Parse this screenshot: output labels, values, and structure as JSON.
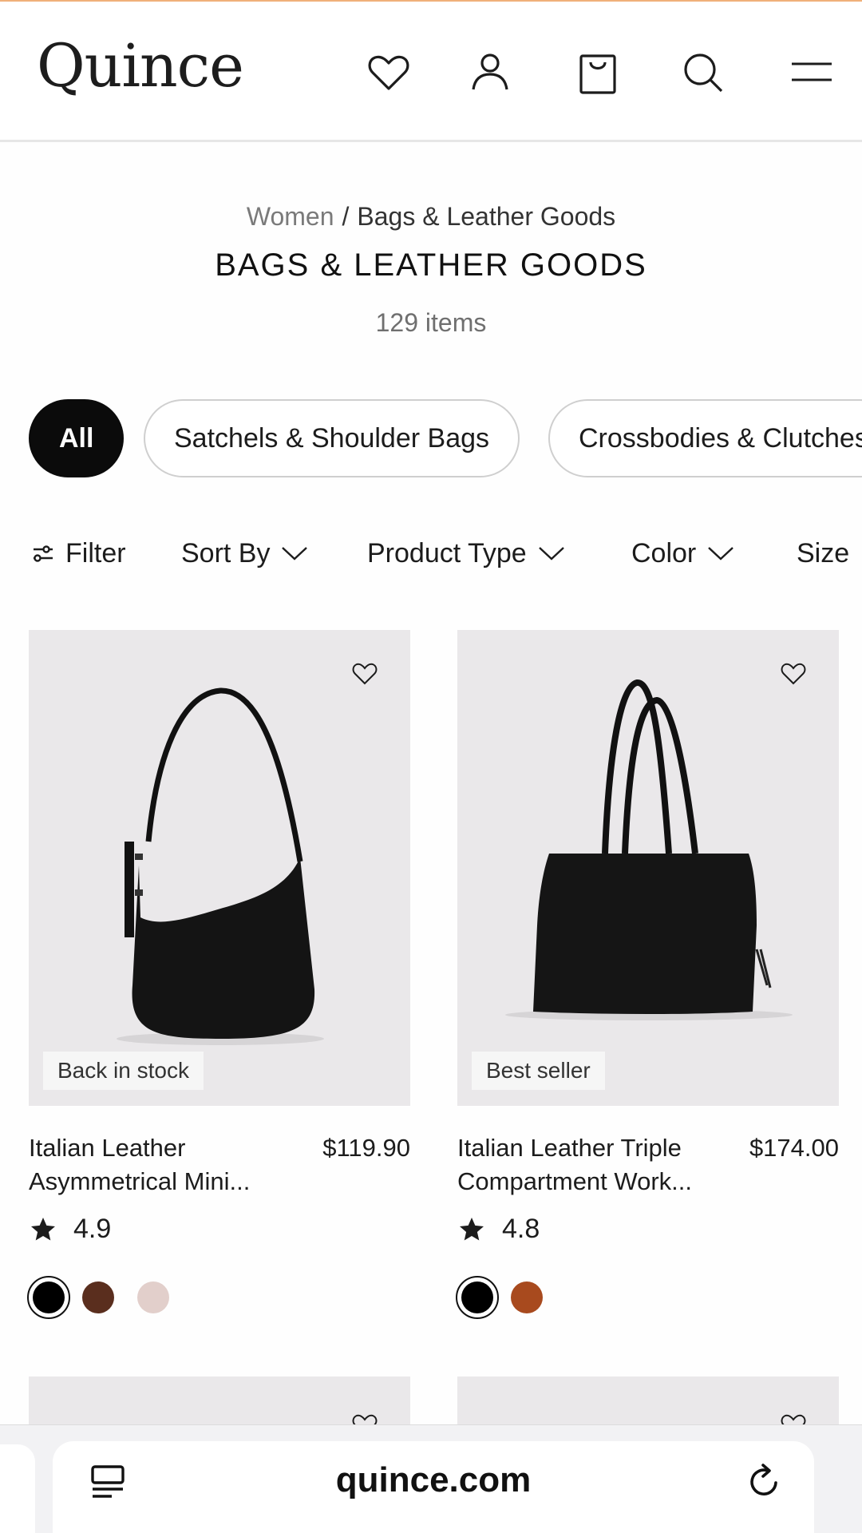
{
  "header": {
    "logo": "Quince",
    "icons": [
      "heart-icon",
      "account-icon",
      "bag-icon",
      "search-icon",
      "menu-icon"
    ]
  },
  "breadcrumb": {
    "parent": "Women",
    "separator": "/",
    "current": "Bags & Leather Goods"
  },
  "page": {
    "title": "BAGS & LEATHER GOODS",
    "item_count": "129 items"
  },
  "categories": [
    {
      "label": "All",
      "active": true
    },
    {
      "label": "Satchels & Shoulder Bags",
      "active": false
    },
    {
      "label": "Crossbodies & Clutches",
      "active": false
    }
  ],
  "filters": {
    "filter": "Filter",
    "sort_by": "Sort By",
    "product_type": "Product Type",
    "color": "Color",
    "size": "Size"
  },
  "products": [
    {
      "badge": "Back in stock",
      "name": "Italian Leather Asymmetrical Mini...",
      "price": "$119.90",
      "rating": "4.9",
      "swatches": [
        "#000000",
        "#5a2e1e",
        "#e2cfcb"
      ],
      "selected_swatch": 0
    },
    {
      "badge": "Best seller",
      "name": "Italian Leather Triple Compartment Work...",
      "price": "$174.00",
      "rating": "4.8",
      "swatches": [
        "#000000",
        "#a84a1e"
      ],
      "selected_swatch": 0
    }
  ],
  "browser": {
    "url": "quince.com"
  },
  "colors": {
    "accent_top_line": "#f0b07a",
    "product_bg": "#eae8ea",
    "chip_active": "#0b0b0b"
  }
}
